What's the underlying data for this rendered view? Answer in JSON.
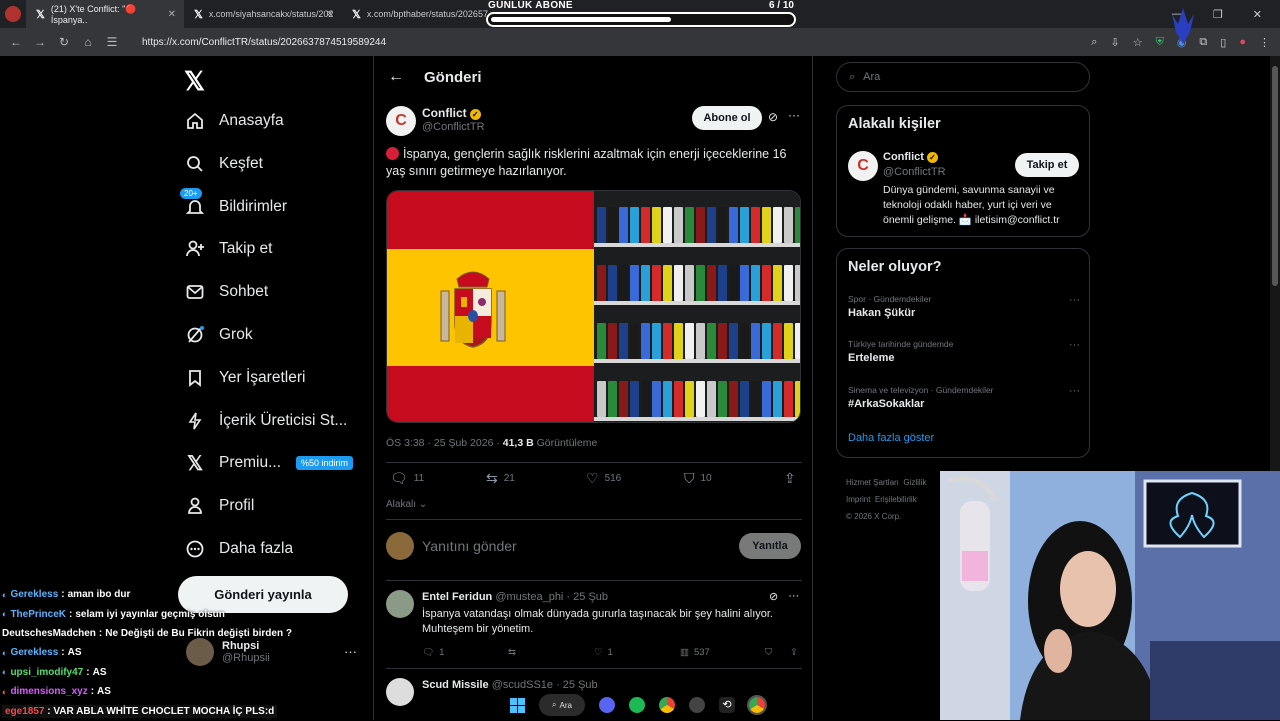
{
  "browser": {
    "tabs": [
      {
        "label": "(21) X'te Conflict: \"🔴 İspanya..",
        "active": true
      },
      {
        "label": "x.com/siyahsancakx/status/202",
        "active": false
      },
      {
        "label": "x.com/bpthaber/status/202657",
        "active": false
      }
    ],
    "url": "https://x.com/ConflictTR/status/2026637874519589244"
  },
  "overlay": {
    "subscriber_goal_title": "GÜNLÜK ABONE",
    "subscriber_goal_count": "6 / 10",
    "subscriber_progress": 0.6
  },
  "nav": {
    "items": [
      {
        "label": "Anasayfa",
        "icon": "home-icon"
      },
      {
        "label": "Keşfet",
        "icon": "search-icon"
      },
      {
        "label": "Bildirimler",
        "icon": "bell-icon",
        "badge": "20+"
      },
      {
        "label": "Takip et",
        "icon": "person-add-icon"
      },
      {
        "label": "Sohbet",
        "icon": "mail-icon"
      },
      {
        "label": "Grok",
        "icon": "grok-icon"
      },
      {
        "label": "Yer İşaretleri",
        "icon": "bookmark-icon"
      },
      {
        "label": "İçerik Üreticisi St...",
        "icon": "lightning-icon"
      },
      {
        "label": "Premiu...",
        "icon": "x-icon",
        "badge": "%50 indirim"
      },
      {
        "label": "Profil",
        "icon": "person-icon"
      },
      {
        "label": "Daha fazla",
        "icon": "more-circle-icon"
      }
    ],
    "post_button": "Gönderi yayınla",
    "account_name": "Rhupsi",
    "account_handle": "@Rhupsii"
  },
  "chat": [
    {
      "user": "Gerekless",
      "message": "aman ibo dur",
      "color": "#5ab4ff"
    },
    {
      "user": "ThePrinceK",
      "message": "selam iyi yayınlar geçmiş olsun",
      "color": "#5ab4ff"
    },
    {
      "user": "DeutschesMadchen",
      "message": "Ne Değişti de Bu Fikrin değişti birden ?",
      "color": "#ffffff"
    },
    {
      "user": "Gerekless",
      "message": "AS",
      "color": "#5ab4ff"
    },
    {
      "user": "upsi_imodify47",
      "message": "AS",
      "color": "#4fe06a"
    },
    {
      "user": "dimensions_xyz",
      "message": "AS",
      "color": "#d85cff"
    },
    {
      "user": "ege1857",
      "message": "VAR ABLA WHİTE CHOCLET MOCHA İÇ PLS:d",
      "color": "#ff4a4a"
    }
  ],
  "main": {
    "title": "Gönderi",
    "tweet": {
      "author_name": "Conflict",
      "author_handle": "@ConflictTR",
      "subscribe_label": "Abone ol",
      "text": "İspanya, gençlerin sağlık risklerini azaltmak için enerji içeceklerine 16 yaş sınırı getirmeye hazırlanıyor.",
      "time": "ÖS 3:38 · 25 Şub 2026 ·",
      "views": "41,3 B",
      "views_label": "Görüntüleme",
      "replies": "11",
      "reposts": "21",
      "likes": "516",
      "bookmarks": "10"
    },
    "related_label": "Alakalı",
    "reply_placeholder": "Yanıtını gönder",
    "reply_button": "Yanıtla",
    "replies": [
      {
        "name": "Entel Feridun",
        "handle": "@mustea_phi · 25 Şub",
        "text": "İspanya vatandaşı olmak dünyada gururla taşınacak bir şey halini alıyor. Muhteşem bir yönetim.",
        "replies": "1",
        "likes": "1",
        "views": "537"
      },
      {
        "name": "Scud Missile",
        "handle": "@scudSS1e · 25 Şub"
      }
    ]
  },
  "right": {
    "search_placeholder": "Ara",
    "related_people_title": "Alakalı kişiler",
    "person": {
      "name": "Conflict",
      "handle": "@ConflictTR",
      "follow_label": "Takip et",
      "bio": "Dünya gündemi, savunma sanayii ve teknoloji odaklı haber, yurt içi veri ve önemli gelişme. 📩 iletisim@conflict.tr"
    },
    "trends_title": "Neler oluyor?",
    "trends": [
      {
        "meta": "Spor · Gündemdekiler",
        "name": "Hakan Şükür"
      },
      {
        "meta": "Türkiye tarihinde gündemde",
        "name": "Erteleme"
      },
      {
        "meta": "Sinema ve televizyon · Gündemdekiler",
        "name": "#ArkaSokaklar"
      }
    ],
    "show_more": "Daha fazla göster",
    "footer": [
      "Hizmet Şartları",
      "Gizlilik",
      "Imprint",
      "Erişilebilirlik",
      "© 2026 X Corp."
    ]
  },
  "taskbar": {
    "search_label": "Ara"
  },
  "colors": {
    "accent": "#1d9bf0",
    "spain_red": "#c60b1e",
    "spain_yellow": "#ffc400"
  }
}
